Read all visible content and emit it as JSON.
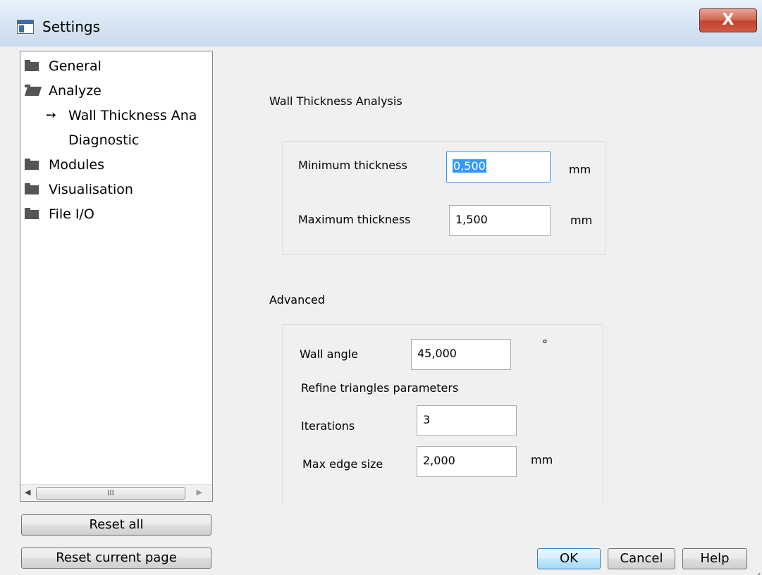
{
  "window": {
    "title": "Settings",
    "close_label": "X"
  },
  "tree": {
    "items": [
      {
        "label": "General",
        "icon": "folder-icon"
      },
      {
        "label": "Analyze",
        "icon": "folder-open-icon"
      },
      {
        "label": "Wall Thickness Ana",
        "icon": "arrow-icon"
      },
      {
        "label": "Diagnostic"
      },
      {
        "label": "Modules",
        "icon": "folder-icon"
      },
      {
        "label": "Visualisation",
        "icon": "folder-icon"
      },
      {
        "label": "File I/O",
        "icon": "folder-icon"
      }
    ],
    "scroll_thumb": "III"
  },
  "sections": {
    "wall_thickness": {
      "title": "Wall Thickness Analysis",
      "min_label": "Minimum thickness",
      "min_value": "0,500",
      "min_unit": "mm",
      "max_label": "Maximum thickness",
      "max_value": "1,500",
      "max_unit": "mm"
    },
    "advanced": {
      "title": "Advanced",
      "wall_angle_label": "Wall angle",
      "wall_angle_value": "45,000",
      "wall_angle_unit": "°",
      "refine_label": "Refine triangles parameters",
      "iterations_label": "Iterations",
      "iterations_value": "3",
      "edge_label": "Max edge size",
      "edge_value": "2,000",
      "edge_unit": "mm"
    }
  },
  "buttons": {
    "reset_all": "Reset all",
    "reset_page": "Reset current page",
    "ok": "OK",
    "cancel": "Cancel",
    "help": "Help"
  }
}
